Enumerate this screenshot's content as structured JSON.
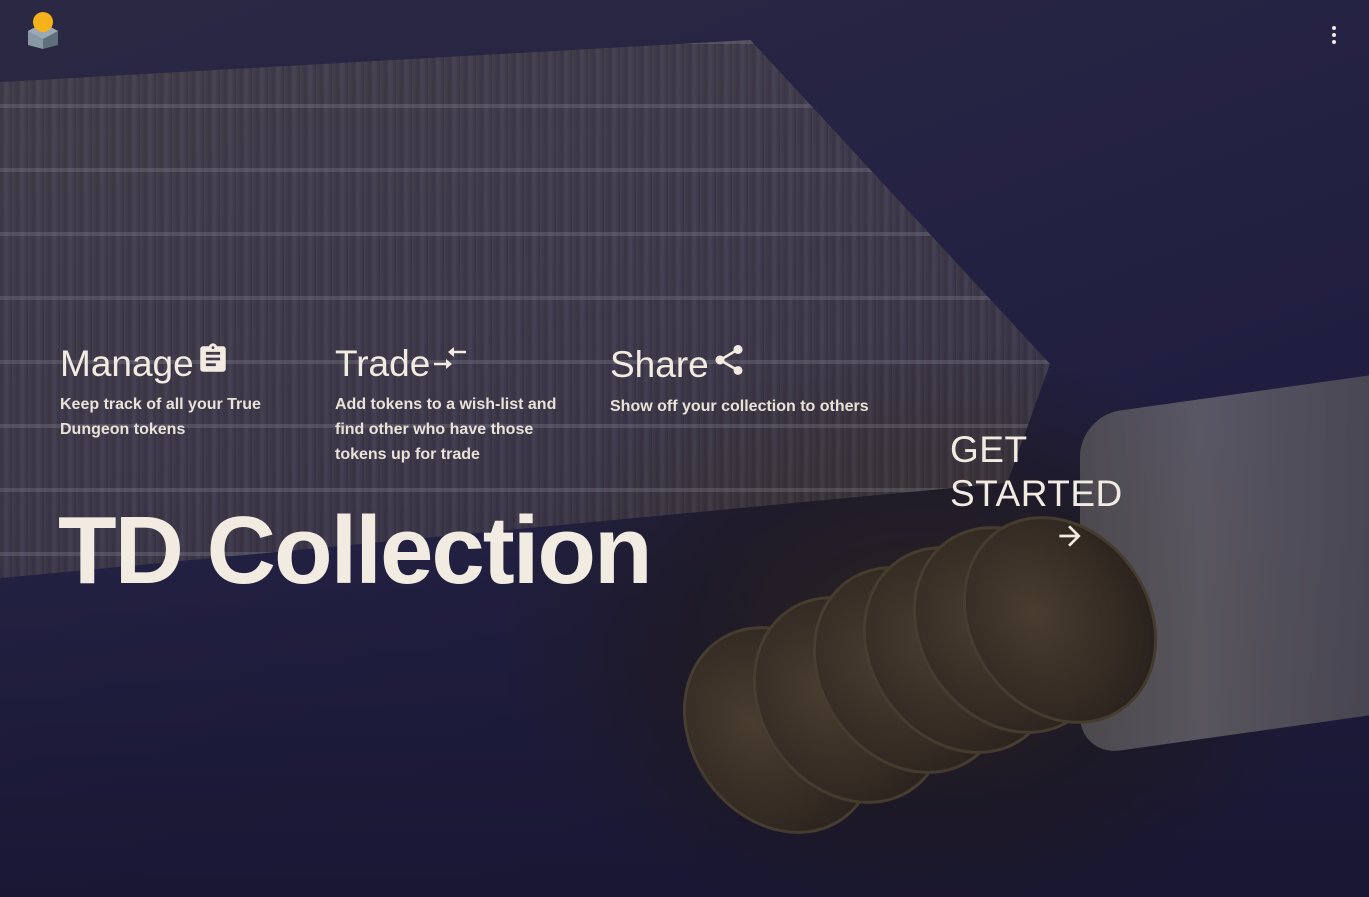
{
  "header": {
    "logo_icon": "cube-logo-icon",
    "menu_icon": "more-vertical-icon"
  },
  "features": [
    {
      "title": "Manage",
      "icon": "clipboard-icon",
      "description": "Keep track of all your True Dungeon tokens"
    },
    {
      "title": "Trade",
      "icon": "swap-arrows-icon",
      "description": "Add tokens to a wish-list and find other who have those tokens up for trade"
    },
    {
      "title": "Share",
      "icon": "share-icon",
      "description": "Show off your collection to others"
    }
  ],
  "hero": {
    "title": "TD Collection"
  },
  "cta": {
    "label": "GET STARTED",
    "icon": "arrow-right-icon"
  },
  "colors": {
    "text": "#f2ebe2",
    "background": "#2c2a55",
    "logo_top": "#f5b21a",
    "logo_side": "#7f8e9c"
  }
}
